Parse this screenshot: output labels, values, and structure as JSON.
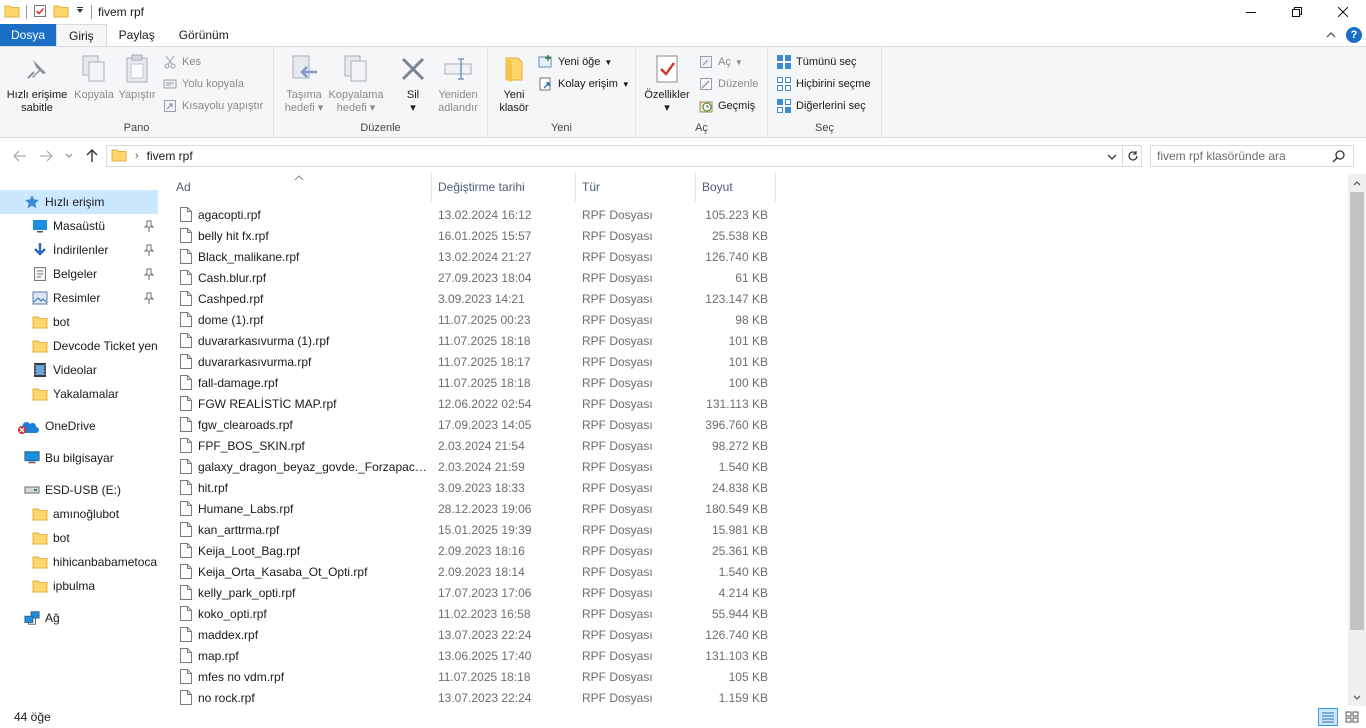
{
  "window": {
    "title": "fivem rpf"
  },
  "tabs": {
    "file": "Dosya",
    "home": "Giriş",
    "share": "Paylaş",
    "view": "Görünüm"
  },
  "ribbon": {
    "pano": {
      "label": "Pano",
      "pin_line1": "Hızlı erişime",
      "pin_line2": "sabitle",
      "copy": "Kopyala",
      "paste": "Yapıştır",
      "cut": "Kes",
      "copy_path": "Yolu kopyala",
      "paste_shortcut": "Kısayolu yapıştır"
    },
    "duzenle": {
      "label": "Düzenle",
      "move_line1": "Taşıma",
      "move_line2": "hedefi",
      "copyto_line1": "Kopyalama",
      "copyto_line2": "hedefi",
      "delete": "Sil",
      "rename_line1": "Yeniden",
      "rename_line2": "adlandır"
    },
    "yeni": {
      "label": "Yeni",
      "new_folder_line1": "Yeni",
      "new_folder_line2": "klasör",
      "new_item": "Yeni öğe",
      "easy_access": "Kolay erişim"
    },
    "ac": {
      "label": "Aç",
      "properties": "Özellikler",
      "open": "Aç",
      "edit": "Düzenle",
      "history": "Geçmiş"
    },
    "sec": {
      "label": "Seç",
      "select_all": "Tümünü seç",
      "select_none": "Hiçbirini seçme",
      "invert": "Diğerlerini seç"
    }
  },
  "address": {
    "path": "fivem rpf",
    "search_placeholder": "fivem rpf klasöründe ara"
  },
  "nav": [
    {
      "label": "Hızlı erişim",
      "icon": "star-icon",
      "indent": 0,
      "pinned": false,
      "selected": true
    },
    {
      "label": "Masaüstü",
      "icon": "desktop-icon",
      "indent": 1,
      "pinned": true
    },
    {
      "label": "İndirilenler",
      "icon": "download-icon",
      "indent": 1,
      "pinned": true
    },
    {
      "label": "Belgeler",
      "icon": "documents-icon",
      "indent": 1,
      "pinned": true
    },
    {
      "label": "Resimler",
      "icon": "pictures-icon",
      "indent": 1,
      "pinned": true
    },
    {
      "label": "bot",
      "icon": "folder-icon",
      "indent": 1,
      "pinned": false
    },
    {
      "label": "Devcode Ticket yen",
      "icon": "folder-icon",
      "indent": 1,
      "pinned": false
    },
    {
      "label": "Videolar",
      "icon": "videos-icon",
      "indent": 1,
      "pinned": false
    },
    {
      "label": "Yakalamalar",
      "icon": "folder-icon",
      "indent": 1,
      "pinned": false
    },
    {
      "label": "OneDrive",
      "icon": "onedrive-icon",
      "indent": 0,
      "pinned": false,
      "gap": true
    },
    {
      "label": "Bu bilgisayar",
      "icon": "computer-icon",
      "indent": 0,
      "pinned": false,
      "gap": true
    },
    {
      "label": "ESD-USB (E:)",
      "icon": "usb-drive-icon",
      "indent": 0,
      "pinned": false,
      "gap": true
    },
    {
      "label": "amınoğlubot",
      "icon": "folder-icon",
      "indent": 1,
      "pinned": false
    },
    {
      "label": "bot",
      "icon": "folder-icon",
      "indent": 1,
      "pinned": false
    },
    {
      "label": "hihicanbabametoca",
      "icon": "folder-icon",
      "indent": 1,
      "pinned": false
    },
    {
      "label": "ipbulma",
      "icon": "folder-icon",
      "indent": 1,
      "pinned": false
    },
    {
      "label": "Ağ",
      "icon": "network-icon",
      "indent": 0,
      "pinned": false,
      "gap": true
    }
  ],
  "columns": {
    "name": "Ad",
    "modified": "Değiştirme tarihi",
    "type": "Tür",
    "size": "Boyut"
  },
  "files": [
    {
      "name": "agacopti.rpf",
      "date": "13.02.2024 16:12",
      "type": "RPF Dosyası",
      "size": "105.223 KB"
    },
    {
      "name": "belly hit fx.rpf",
      "date": "16.01.2025 15:57",
      "type": "RPF Dosyası",
      "size": "25.538 KB"
    },
    {
      "name": "Black_malikane.rpf",
      "date": "13.02.2024 21:27",
      "type": "RPF Dosyası",
      "size": "126.740 KB"
    },
    {
      "name": "Cash.blur.rpf",
      "date": "27.09.2023 18:04",
      "type": "RPF Dosyası",
      "size": "61 KB"
    },
    {
      "name": "Cashped.rpf",
      "date": "3.09.2023 14:21",
      "type": "RPF Dosyası",
      "size": "123.147 KB"
    },
    {
      "name": "dome (1).rpf",
      "date": "11.07.2025 00:23",
      "type": "RPF Dosyası",
      "size": "98 KB"
    },
    {
      "name": "duvararkasıvurma (1).rpf",
      "date": "11.07.2025 18:18",
      "type": "RPF Dosyası",
      "size": "101 KB"
    },
    {
      "name": "duvararkasıvurma.rpf",
      "date": "11.07.2025 18:17",
      "type": "RPF Dosyası",
      "size": "101 KB"
    },
    {
      "name": "fall-damage.rpf",
      "date": "11.07.2025 18:18",
      "type": "RPF Dosyası",
      "size": "100 KB"
    },
    {
      "name": "FGW REALİSTİC MAP.rpf",
      "date": "12.06.2022 02:54",
      "type": "RPF Dosyası",
      "size": "131.113 KB"
    },
    {
      "name": "fgw_clearoads.rpf",
      "date": "17.09.2023 14:05",
      "type": "RPF Dosyası",
      "size": "396.760 KB"
    },
    {
      "name": "FPF_BOS_SKIN.rpf",
      "date": "2.03.2024 21:54",
      "type": "RPF Dosyası",
      "size": "98.272 KB"
    },
    {
      "name": "galaxy_dragon_beyaz_govde._Forzapack_...",
      "date": "2.03.2024 21:59",
      "type": "RPF Dosyası",
      "size": "1.540 KB"
    },
    {
      "name": "hit.rpf",
      "date": "3.09.2023 18:33",
      "type": "RPF Dosyası",
      "size": "24.838 KB"
    },
    {
      "name": "Humane_Labs.rpf",
      "date": "28.12.2023 19:06",
      "type": "RPF Dosyası",
      "size": "180.549 KB"
    },
    {
      "name": "kan_arttrma.rpf",
      "date": "15.01.2025 19:39",
      "type": "RPF Dosyası",
      "size": "15.981 KB"
    },
    {
      "name": "Keija_Loot_Bag.rpf",
      "date": "2.09.2023 18:16",
      "type": "RPF Dosyası",
      "size": "25.361 KB"
    },
    {
      "name": "Keija_Orta_Kasaba_Ot_Opti.rpf",
      "date": "2.09.2023 18:14",
      "type": "RPF Dosyası",
      "size": "1.540 KB"
    },
    {
      "name": "kelly_park_opti.rpf",
      "date": "17.07.2023 17:06",
      "type": "RPF Dosyası",
      "size": "4.214 KB"
    },
    {
      "name": "koko_opti.rpf",
      "date": "11.02.2023 16:58",
      "type": "RPF Dosyası",
      "size": "55.944 KB"
    },
    {
      "name": "maddex.rpf",
      "date": "13.07.2023 22:24",
      "type": "RPF Dosyası",
      "size": "126.740 KB"
    },
    {
      "name": "map.rpf",
      "date": "13.06.2025 17:40",
      "type": "RPF Dosyası",
      "size": "131.103 KB"
    },
    {
      "name": "mfes no vdm.rpf",
      "date": "11.07.2025 18:18",
      "type": "RPF Dosyası",
      "size": "105 KB"
    },
    {
      "name": "no rock.rpf",
      "date": "13.07.2023 22:24",
      "type": "RPF Dosyası",
      "size": "1.159 KB"
    }
  ],
  "status": {
    "count": "44 öğe"
  },
  "colors": {
    "accent": "#1a6fc4",
    "selection": "#cce8ff",
    "folder": "#ffd669"
  }
}
